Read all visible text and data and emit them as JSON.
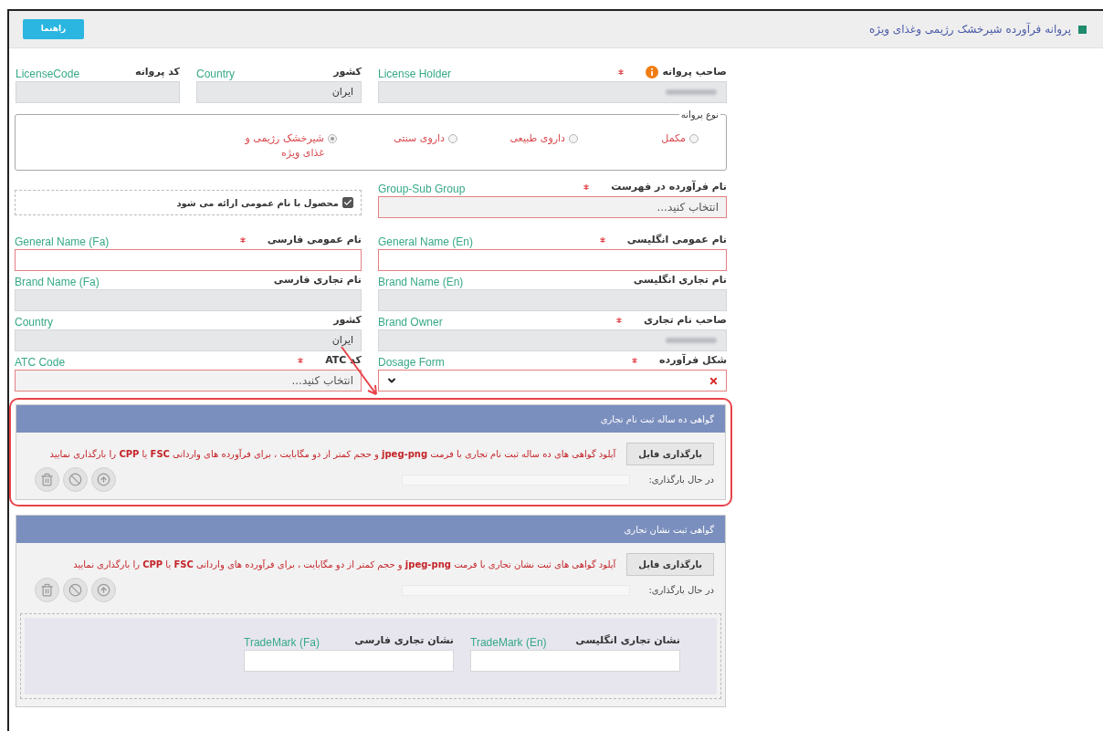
{
  "header": {
    "title": "پروانه فرآورده شیرخشک رژیمی وغذای ویژه",
    "help_button": "راهنما"
  },
  "top_row": [
    {
      "kind": "text",
      "label": "صاحب پروانه",
      "en": "License Holder",
      "required": true,
      "info": true,
      "disabled": true,
      "redacted": true
    },
    {
      "kind": "text",
      "label": "کشور",
      "en": "Country",
      "required": false,
      "info": false,
      "disabled": true,
      "value": "ایران"
    },
    {
      "kind": "text",
      "label": "کد پروانه",
      "en": "LicenseCode",
      "required": false,
      "info": false,
      "disabled": true
    }
  ],
  "license_type": {
    "legend": "نوع پروانه",
    "options": [
      {
        "label": "مکمل",
        "selected": false
      },
      {
        "label": "داروی طبیعی",
        "selected": false
      },
      {
        "label": "داروی سنتی",
        "selected": false
      },
      {
        "label": "شیرخشک رژیمی و غذای ویژه",
        "selected": true
      }
    ]
  },
  "rows": [
    [
      {
        "kind": "select",
        "label": "نام فرآورده در فهرست",
        "en": "Group-Sub Group",
        "required": true,
        "invalid": true,
        "placeholder": "انتخاب کنید..."
      },
      {
        "kind": "checkbox",
        "label": "محصول با نام عمومی ارائه می شود",
        "checked": true
      }
    ],
    [
      {
        "kind": "text",
        "label": "نام عمومی انگلیسی",
        "en": "General Name (En)",
        "required": true,
        "invalid": true,
        "disabled": false
      },
      {
        "kind": "text",
        "label": "نام عمومی فارسی",
        "en": "General Name (Fa)",
        "required": true,
        "invalid": true,
        "disabled": false
      }
    ],
    [
      {
        "kind": "text",
        "label": "نام تجاری انگلیسی",
        "en": "Brand Name (En)",
        "required": false,
        "disabled": true
      },
      {
        "kind": "text",
        "label": "نام تجاری فارسی",
        "en": "Brand Name (Fa)",
        "required": false,
        "disabled": true
      }
    ],
    [
      {
        "kind": "text",
        "label": "صاحب نام تجاری",
        "en": "Brand Owner",
        "required": true,
        "disabled": true,
        "redacted": true
      },
      {
        "kind": "text",
        "label": "کشور",
        "en": "Country",
        "required": false,
        "disabled": true,
        "value": "ایران"
      }
    ],
    [
      {
        "kind": "clearable",
        "label": "شکل فرآورده",
        "en": "Dosage Form",
        "required": true,
        "invalid": true
      },
      {
        "kind": "select",
        "label": "کد ATC",
        "en": "ATC Code",
        "required": true,
        "invalid": true,
        "placeholder": "انتخاب کنید..."
      }
    ]
  ],
  "sections": [
    {
      "title": "گواهی ده ساله ثبت نام تجاری",
      "highlighted": true,
      "upload_button": "بارگذاری فایل",
      "note": "آپلود گواهی های ده ساله ثبت نام تجاری با فرمت **jpeg-png** و حجم کمتر از دو مگابایت ، برای فرآورده های وارداتی **FSC** یا **CPP** را بارگذاری نمایید",
      "progress_label": "در حال بارگذاری:"
    },
    {
      "title": "گواهی ثبت نشان تجاری",
      "highlighted": false,
      "upload_button": "بارگذاری فایل",
      "note": "آپلود گواهی های ثبت نشان تجاری با فرمت **jpeg-png** و حجم کمتر از دو مگابایت ، برای فرآورده های وارداتی **FSC** یا **CPP** را بارگذاری نمایید",
      "progress_label": "در حال بارگذاری:",
      "trademarks": [
        {
          "label": "نشان تجاری انگلیسی",
          "en": "TradeMark (En)"
        },
        {
          "label": "نشان تجاری فارسی",
          "en": "TradeMark (Fa)"
        }
      ]
    }
  ]
}
